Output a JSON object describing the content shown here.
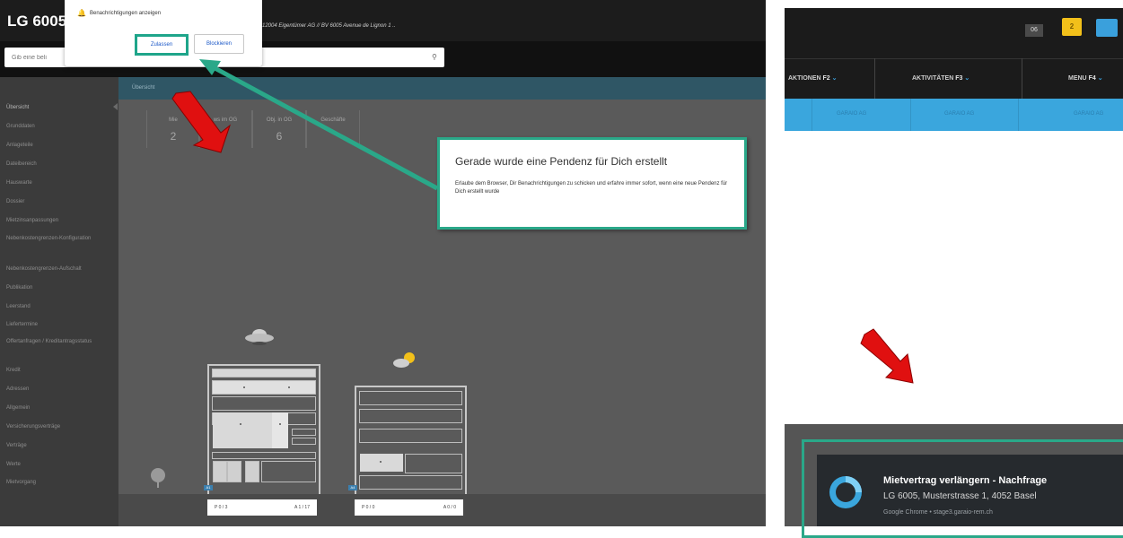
{
  "app": {
    "title": "LG 6005,",
    "breadcrumb": "C 12004 Eigentümer AG  //  BV 6005 Avenue de Lignon 1 ..",
    "search_placeholder": "Gib eine beli"
  },
  "notification_prompt": {
    "text": "Benachrichtigungen anzeigen",
    "allow_label": "Zulassen",
    "block_label": "Blockieren"
  },
  "tabs": {
    "active": "Übersicht"
  },
  "sidebar": {
    "items": [
      {
        "label": "Übersicht"
      },
      {
        "label": "Grunddaten"
      },
      {
        "label": "Anlageteile"
      },
      {
        "label": "Dateibereich"
      },
      {
        "label": "Hauswarte"
      },
      {
        "label": "Dossier"
      },
      {
        "label": "Mietzinsanpassungen"
      },
      {
        "label": "Nebenkostengrenzen-Konfiguration"
      },
      {
        "label": "Nebenkostengrenzen-Aufschalt"
      },
      {
        "label": "Publikation"
      },
      {
        "label": "Leerstand"
      },
      {
        "label": "Liefertermine"
      },
      {
        "label": "Offertanfragen / Kreditantragsstatus"
      },
      {
        "label": "Kredit"
      },
      {
        "label": "Adressen"
      },
      {
        "label": "Allgemein"
      },
      {
        "label": "Versicherungsverträge"
      },
      {
        "label": "Verträge"
      },
      {
        "label": "Werte"
      },
      {
        "label": "Mietvorgang"
      }
    ]
  },
  "stats": [
    {
      "label": "Mie",
      "value": "2"
    },
    {
      "label": "ws im OG",
      "value": ""
    },
    {
      "label": "Obj. in OG",
      "value": "6"
    },
    {
      "label": "Geschäfte",
      "value": ""
    }
  ],
  "buildings": [
    {
      "left_label": "P 0 / 3",
      "right_label": "A 1 / 17",
      "badge": "A1"
    },
    {
      "left_label": "P 0 / 0",
      "right_label": "A 0 / 0",
      "badge": "A4"
    }
  ],
  "callout": {
    "title": "Gerade wurde eine Pendenz für Dich erstellt",
    "body": "Erlaube dem Browser, Dir Benachrichtigungen zu schicken und erfahre immer sofort, wenn eine neue Pendenz für Dich erstellt wurde"
  },
  "header_right": {
    "badge_count": "06",
    "message_badge": "2",
    "menu": [
      {
        "label": "AKTIONEN ",
        "key": "F2"
      },
      {
        "label": "AKTIVITÄTEN ",
        "key": "F3"
      },
      {
        "label": "MENU ",
        "key": "F4"
      }
    ],
    "subtabs": [
      "GARAIO AG",
      "GARAIO AG",
      "GARAIO AG"
    ]
  },
  "os_notification": {
    "title": "Mietvertrag verlängern - Nachfrage",
    "subtitle": "LG 6005, Musterstrasse 1, 4052 Basel",
    "source": "Google Chrome • stage3.garaio-rem.ch"
  },
  "colors": {
    "highlight": "#2aa889",
    "arrow_red": "#e01010",
    "tab_bar": "#2f5665",
    "accent_blue": "#3aa6dd",
    "message_yellow": "#f2c01a"
  }
}
